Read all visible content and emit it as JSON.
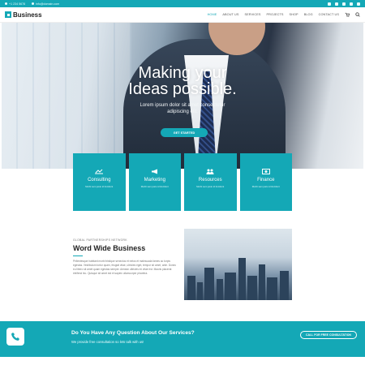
{
  "topbar": {
    "phone": "+1 234 5678",
    "email": "info@domain.com",
    "socials": [
      "facebook-icon",
      "twitter-icon",
      "google-plus-icon",
      "linkedin-icon",
      "instagram-icon"
    ]
  },
  "header": {
    "logo_text": "Business",
    "nav": [
      "HOME",
      "ABOUT US",
      "SERVICES",
      "PROJECTS",
      "SHOP",
      "BLOG",
      "CONTACT US"
    ]
  },
  "hero": {
    "title_line1": "Making your",
    "title_line2": "Ideas possible.",
    "subtitle_line1": "Lorem ipsum dolor sit amet consectetur",
    "subtitle_line2": "adipiscing elit.",
    "cta": "GET STARTED"
  },
  "features": [
    {
      "title": "Consulting",
      "desc": "Morbi sem justo id tincidunt",
      "icon": "chart-icon"
    },
    {
      "title": "Marketing",
      "desc": "Morbi sem justo id tincidunt",
      "icon": "megaphone-icon"
    },
    {
      "title": "Resources",
      "desc": "Morbi sem justo id tincidunt",
      "icon": "people-icon"
    },
    {
      "title": "Finance",
      "desc": "Morbi sem justo id tincidunt",
      "icon": "money-icon"
    }
  ],
  "about": {
    "eyebrow": "GLOBAL PARTNERSHIPS NETWORK",
    "title": "Word Wide Business",
    "body": "Pellentesque habitant morbi tristique senectus et netus et malesuada fames ac turpis egestas. Vestibulum tortor quam, feugiat vitae, ultricies eget, tempor sit amet, ante. Donec eu libero sit amet quam egestas semper. Aenean ultricies mi vitae est. Mauris placerat eleifend leo. Quisque sit amet est et sapien ullamcorper pharetra."
  },
  "banner": {
    "question": "Do You Have Any Question About Our Services?",
    "sub": "We provide free consultation so lets talk with us!",
    "button": "CALL FOR FREE CONSULTATION"
  },
  "colors": {
    "accent": "#14a8b6"
  }
}
